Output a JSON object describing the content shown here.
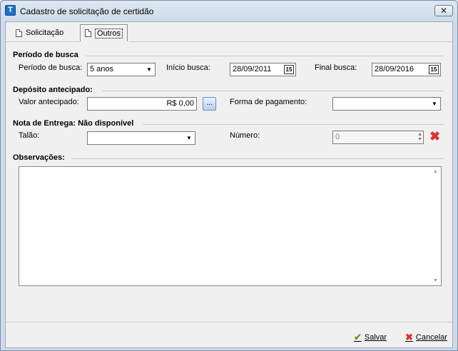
{
  "window": {
    "title": "Cadastro de solicitação de certidão",
    "icon": "app-t-icon",
    "close_label": "✕"
  },
  "tabs": [
    {
      "label": "Solicitação",
      "icon": "document-icon",
      "active": false
    },
    {
      "label": "Outros",
      "icon": "document-icon",
      "active": true
    }
  ],
  "periodo": {
    "section_title": "Período de busca",
    "periodo_label": "Período de busca:",
    "periodo_value": "5 anos",
    "inicio_label": "Início busca:",
    "inicio_value": "28/09/2011",
    "final_label": "Final busca:",
    "final_value": "28/09/2016",
    "calendar_glyph": "15"
  },
  "deposito": {
    "section_title": "Depósito antecipado:",
    "valor_label": "Valor antecipado:",
    "valor_value": "R$ 0,00",
    "ellipsis_label": "...",
    "forma_label": "Forma de pagamento:",
    "forma_value": ""
  },
  "nota": {
    "section_title": "Nota de Entrega: Não disponível",
    "talao_label": "Talão:",
    "talao_value": "",
    "numero_label": "Número:",
    "numero_value": "0"
  },
  "observacoes": {
    "section_title": "Observações:",
    "value": ""
  },
  "actions": {
    "save_label": "Salvar",
    "cancel_label": "Cancelar"
  },
  "colors": {
    "accent": "#1e6fc8",
    "save": "#5aa02c",
    "cancel": "#dd3333"
  }
}
